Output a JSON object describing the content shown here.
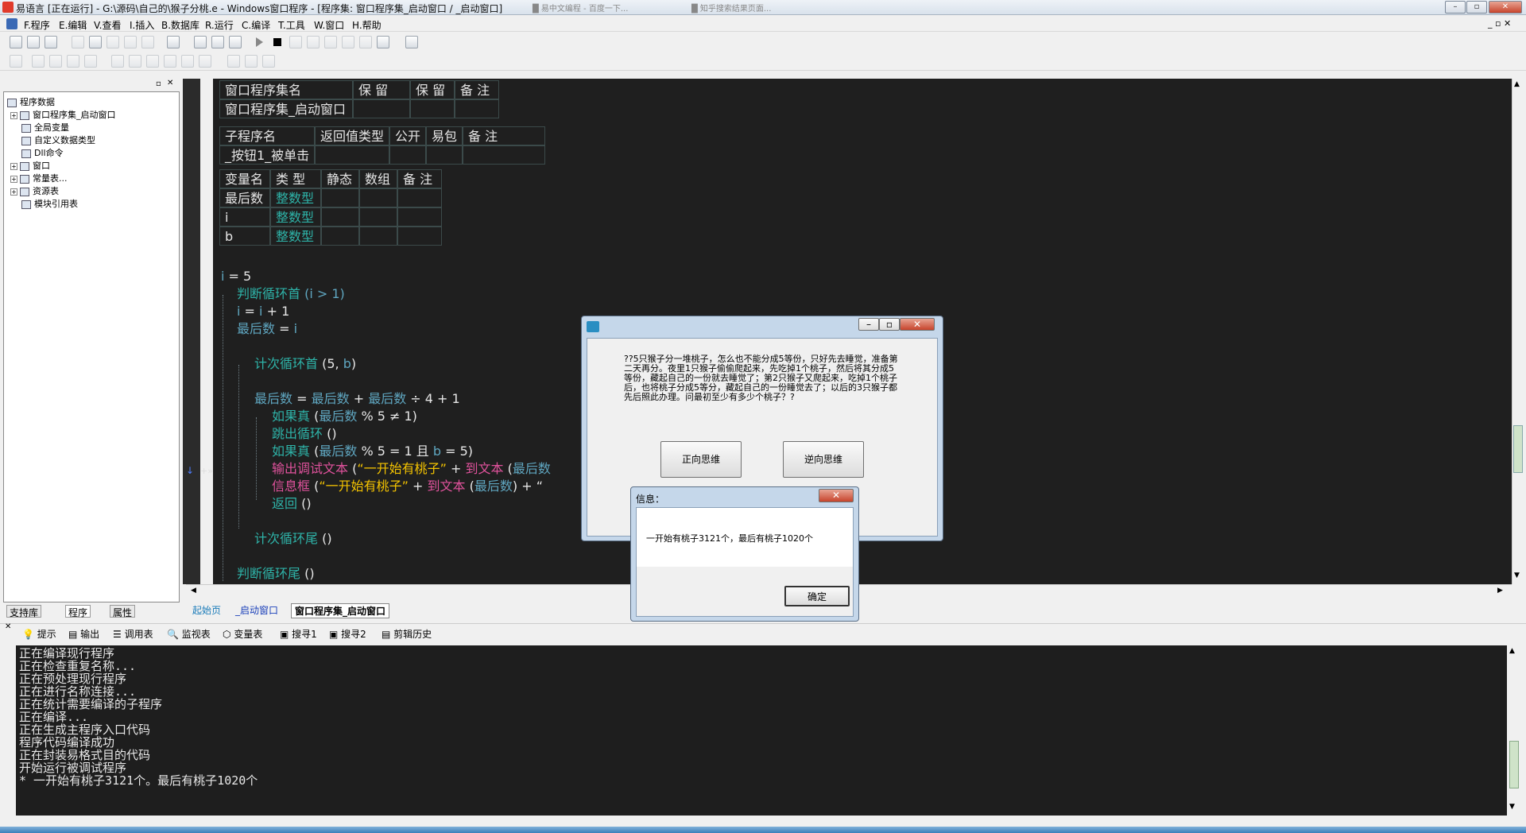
{
  "window": {
    "title": "易语言 [正在运行] - G:\\源码\\自己的\\猴子分桃.e - Windows窗口程序 - [程序集: 窗口程序集_启动窗口 / _启动窗口]",
    "taskbar_hint_1": "█ 易中文编程 - 百度一下...",
    "taskbar_hint_2": "█ 知乎搜索结果页面..."
  },
  "menu": [
    "F.程序",
    "E.编辑",
    "V.查看",
    "I.插入",
    "B.数据库",
    "R.运行",
    "C.编译",
    "T.工具",
    "W.窗口",
    "H.帮助"
  ],
  "tree": {
    "root": "程序数据",
    "items": [
      "窗口程序集_启动窗口",
      "全局变量",
      "自定义数据类型",
      "Dll命令",
      "窗口",
      "常量表...",
      "资源表",
      "模块引用表"
    ]
  },
  "left_tabs": [
    "支持库",
    "程序",
    "属性"
  ],
  "code": {
    "assembly_table": {
      "headers": [
        "窗口程序集名",
        "保 留",
        "保 留",
        "备 注"
      ],
      "row": [
        "窗口程序集_启动窗口",
        "",
        "",
        ""
      ]
    },
    "sub_table": {
      "headers": [
        "子程序名",
        "返回值类型",
        "公开",
        "易包",
        "备 注"
      ],
      "row": [
        "_按钮1_被单击",
        "",
        "",
        "",
        ""
      ]
    },
    "var_table": {
      "headers": [
        "变量名",
        "类 型",
        "静态",
        "数组",
        "备 注"
      ],
      "rows": [
        [
          "最后数",
          "整数型"
        ],
        [
          "i",
          "整数型"
        ],
        [
          "b",
          "整数型"
        ]
      ]
    },
    "lines": {
      "l1a": "i",
      "l1b": " = 5",
      "l2a": "判断循环首",
      "l2b": " (i > 1)",
      "l3a": "i",
      "l3b": " = ",
      "l3c": "i",
      "l3d": " + 1",
      "l4a": "最后数",
      "l4b": " = ",
      "l4c": "i",
      "l5a": "计次循环首",
      "l5b": " (5, ",
      "l5c": "b",
      "l5d": ")",
      "l6a": "最后数",
      "l6b": " = ",
      "l6c": "最后数",
      "l6d": " + ",
      "l6e": "最后数",
      "l6f": " ÷ 4 + 1",
      "l7a": "如果真",
      "l7b": " (",
      "l7c": "最后数",
      "l7d": " % 5 ≠ 1)",
      "l8a": "跳出循环",
      "l8b": " ()",
      "l9a": "如果真",
      "l9b": " (",
      "l9c": "最后数",
      "l9d": " % 5 = 1 且 ",
      "l9e": "b",
      "l9f": " = 5)",
      "l10a": "输出调试文本",
      "l10b": " (",
      "l10c": "“一开始有桃子”",
      "l10d": " + ",
      "l10e": "到文本",
      "l10f": " (",
      "l10g": "最后数",
      "l11a": "信息框",
      "l11b": " (",
      "l11c": "“一开始有桃子”",
      "l11d": " + ",
      "l11e": "到文本",
      "l11f": " (",
      "l11g": "最后数",
      "l11h": ") + “",
      "l12a": "返回",
      "l12b": " ()",
      "l13a": "计次循环尾",
      "l13b": " ()",
      "l14a": "判断循环尾",
      "l14b": " ()"
    }
  },
  "file_tabs": [
    "起始页",
    "_启动窗口",
    "窗口程序集_启动窗口"
  ],
  "output_tabs": [
    "提示",
    "输出",
    "调用表",
    "监视表",
    "变量表",
    "搜寻1",
    "搜寻2",
    "剪辑历史"
  ],
  "output_lines": [
    "正在编译现行程序",
    "正在检查重复名称...",
    "正在预处理现行程序",
    "正在进行名称连接...",
    "正在统计需要编译的子程序",
    "正在编译...",
    "正在生成主程序入口代码",
    "程序代码编译成功",
    "正在封装易格式目的代码",
    "开始运行被调试程序",
    "* 一开始有桃子3121个。最后有桃子1020个"
  ],
  "running_window": {
    "question": "??5只猴子分一堆桃子，怎么也不能分成5等份，只好先去睡觉，准备第二天再分。夜里1只猴子偷偷爬起来，先吃掉1个桃子，然后将其分成5等份，藏起自己的一份就去睡觉了；第2只猴子又爬起来，吃掉1个桃子后，也将桃子分成5等分，藏起自己的一份睡觉去了；以后的3只猴子都先后照此办理。问最初至少有多少个桃子？?",
    "btn_forward": "正向思维",
    "btn_reverse": "逆向思维"
  },
  "msgbox": {
    "title": "信息：",
    "text": "一开始有桃子3121个，最后有桃子1020个",
    "ok": "确定"
  }
}
